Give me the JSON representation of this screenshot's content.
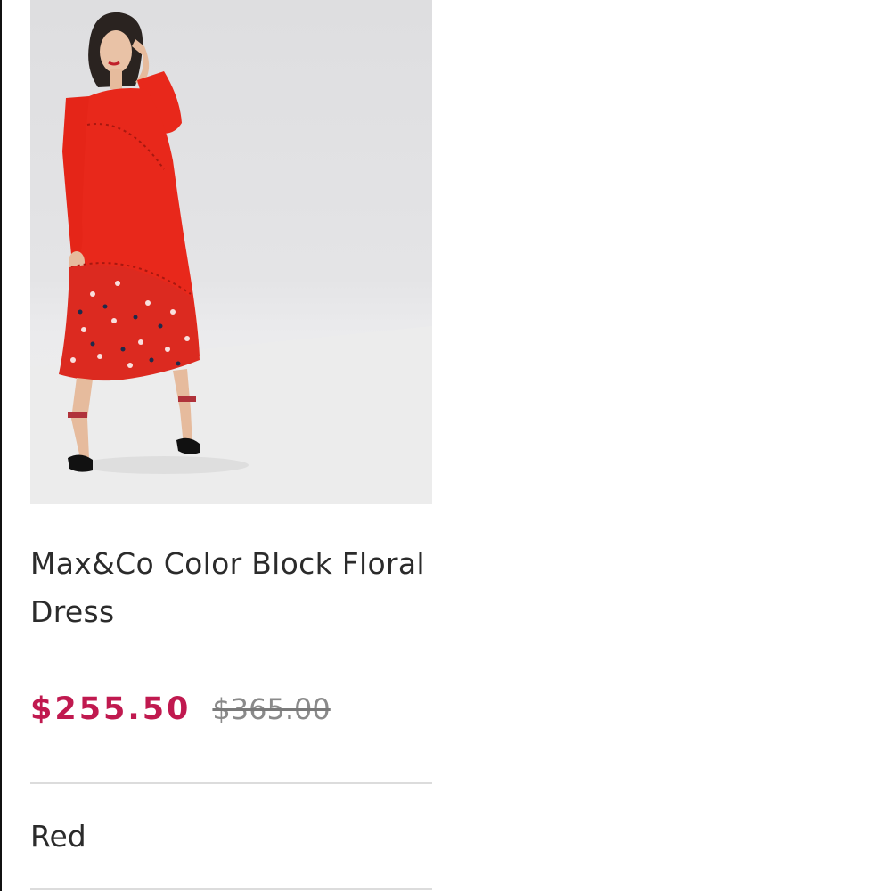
{
  "product": {
    "image_alt": "Model wearing red color block floral midi dress",
    "title": "Max&Co Color Block Floral Dress",
    "sale_price": "$255.50",
    "original_price": "$365.00",
    "color": "Red"
  },
  "colors": {
    "sale_price": "#c0194f",
    "dress": "#e8281b",
    "divider": "#dcdcdc"
  }
}
